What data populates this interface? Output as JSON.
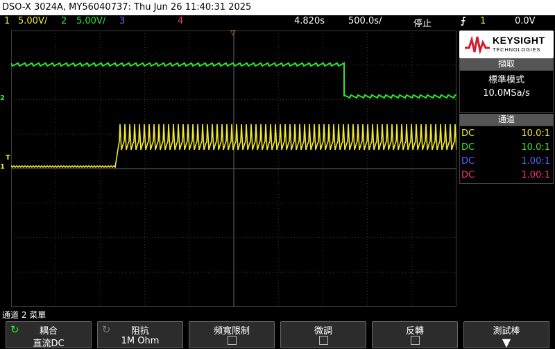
{
  "title": "DSO-X 3024A, MY56040737: Thu Jun 26 11:40:31 2025",
  "status": {
    "ch1_label": "1",
    "ch1_scale": "5.00V/",
    "ch2_label": "2",
    "ch2_scale": "5.00V/",
    "ch3_label": "3",
    "ch4_label": "4",
    "time_pos": "4.820s",
    "time_scale": "500.0s/",
    "run_state": "停止",
    "trig_icon": "trigger-edge-icon",
    "trig_ch": "1",
    "trig_level": "0.0V"
  },
  "brand": {
    "name": "KEYSIGHT",
    "sub": "TECHNOLOGIES"
  },
  "acquire": {
    "header": "擷取",
    "mode": "標準模式",
    "rate": "10.0MSa/s"
  },
  "channels": {
    "header": "通道",
    "rows": [
      {
        "coupling": "DC",
        "probe": "10.0:1",
        "color": "#f2ea2c"
      },
      {
        "coupling": "DC",
        "probe": "10.0:1",
        "color": "#2ee82e"
      },
      {
        "coupling": "DC",
        "probe": "1.00:1",
        "color": "#5566ff"
      },
      {
        "coupling": "DC",
        "probe": "1.00:1",
        "color": "#ff3377"
      }
    ]
  },
  "markers": {
    "ch2": "2",
    "ch1": "1",
    "trig": "T"
  },
  "menu": {
    "title": "通道 2 菜單",
    "keys": [
      {
        "label": "耦合",
        "value": "直流DC"
      },
      {
        "label": "阻抗",
        "value": "1M Ohm"
      },
      {
        "label": "頻寬限制",
        "value": ""
      },
      {
        "label": "微調",
        "value": ""
      },
      {
        "label": "反轉",
        "value": ""
      },
      {
        "label": "測試棒",
        "value": ""
      }
    ]
  },
  "colors": {
    "ch1": "#f2ea2c",
    "ch2": "#2ee82e",
    "ch3": "#5566ff",
    "ch4": "#ff3377"
  }
}
